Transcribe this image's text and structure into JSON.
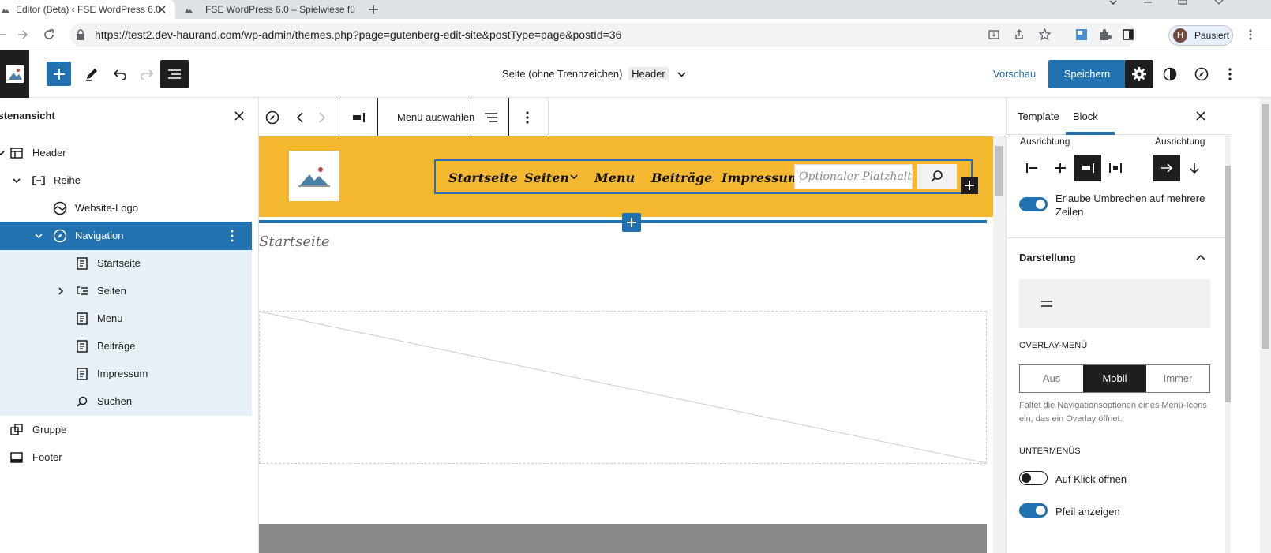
{
  "browser": {
    "tabs": [
      {
        "label": "Editor (Beta) ‹ FSE WordPress 6.0"
      },
      {
        "label": "FSE WordPress 6.0 – Spielwiese fü"
      }
    ],
    "url": "https://test2.dev-haurand.com/wp-admin/themes.php?page=gutenberg-edit-site&postType=page&postId=36",
    "profile_initial": "H",
    "profile_label": "Pausiert"
  },
  "topbar": {
    "doc_title": "Seite (ohne Trennzeichen)",
    "doc_tag": "Header",
    "preview_label": "Vorschau",
    "save_label": "Speichern"
  },
  "listview": {
    "title": "Listenansicht",
    "items": [
      {
        "label": "Header"
      },
      {
        "label": "Reihe"
      },
      {
        "label": "Website-Logo"
      },
      {
        "label": "Navigation"
      },
      {
        "label": "Startseite"
      },
      {
        "label": "Seiten"
      },
      {
        "label": "Menu"
      },
      {
        "label": "Beiträge"
      },
      {
        "label": "Impressum"
      },
      {
        "label": "Suchen"
      },
      {
        "label": "Gruppe"
      },
      {
        "label": "Footer"
      }
    ]
  },
  "canvas": {
    "toolbar_select_menu": "Menü auswählen",
    "nav_items": [
      "Startseite",
      "Seiten",
      "Menu",
      "Beiträge",
      "Impressum"
    ],
    "search_placeholder": "Optionaler Platzhalter",
    "page_heading": "Startseite",
    "header_color": "#f4b730"
  },
  "sidebar": {
    "tabs": [
      {
        "label": "Template"
      },
      {
        "label": "Block"
      }
    ],
    "ausrichtung1": "Ausrichtung",
    "ausrichtung2": "Ausrichtung",
    "wrap_label": "Erlaube Umbrechen auf mehrere Zeilen",
    "darstellung": "Darstellung",
    "overlay_label": "Overlay-Menü",
    "overlay_options": [
      "Aus",
      "Mobil",
      "Immer"
    ],
    "overlay_selected": "Mobil",
    "overlay_help": "Faltet die Navigationsoptionen eines Menü-Icons ein, das ein Overlay öffnet.",
    "untermenus": "Untermenüs",
    "click_open_label": "Auf Klick öffnen",
    "arrow_label": "Pfeil anzeigen",
    "accent": "#2271b1"
  }
}
